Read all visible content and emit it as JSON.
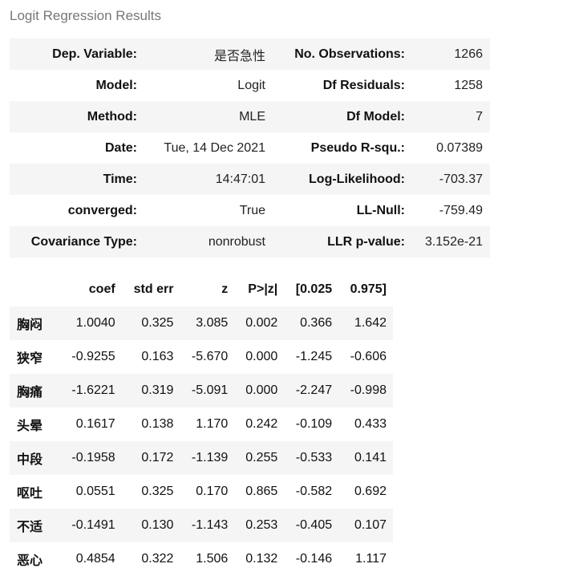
{
  "caption": "Logit Regression Results",
  "summary": {
    "rows": [
      [
        "Dep. Variable:",
        "是否急性",
        "No. Observations:",
        "1266"
      ],
      [
        "Model:",
        "Logit",
        "Df Residuals:",
        "1258"
      ],
      [
        "Method:",
        "MLE",
        "Df Model:",
        "7"
      ],
      [
        "Date:",
        "Tue, 14 Dec 2021",
        "Pseudo R-squ.:",
        "0.07389"
      ],
      [
        "Time:",
        "14:47:01",
        "Log-Likelihood:",
        "-703.37"
      ],
      [
        "converged:",
        "True",
        "LL-Null:",
        "-759.49"
      ],
      [
        "Covariance Type:",
        "nonrobust",
        "LLR p-value:",
        "3.152e-21"
      ]
    ]
  },
  "coef_table": {
    "headers": [
      "",
      "coef",
      "std err",
      "z",
      "P>|z|",
      "[0.025",
      "0.975]"
    ],
    "rows": [
      [
        "胸闷",
        "1.0040",
        "0.325",
        "3.085",
        "0.002",
        "0.366",
        "1.642"
      ],
      [
        "狭窄",
        "-0.9255",
        "0.163",
        "-5.670",
        "0.000",
        "-1.245",
        "-0.606"
      ],
      [
        "胸痛",
        "-1.6221",
        "0.319",
        "-5.091",
        "0.000",
        "-2.247",
        "-0.998"
      ],
      [
        "头晕",
        "0.1617",
        "0.138",
        "1.170",
        "0.242",
        "-0.109",
        "0.433"
      ],
      [
        "中段",
        "-0.1958",
        "0.172",
        "-1.139",
        "0.255",
        "-0.533",
        "0.141"
      ],
      [
        "呕吐",
        "0.0551",
        "0.325",
        "0.170",
        "0.865",
        "-0.582",
        "0.692"
      ],
      [
        "不适",
        "-0.1491",
        "0.130",
        "-1.143",
        "0.253",
        "-0.405",
        "0.107"
      ],
      [
        "恶心",
        "0.4854",
        "0.322",
        "1.506",
        "0.132",
        "-0.146",
        "1.117"
      ]
    ]
  }
}
